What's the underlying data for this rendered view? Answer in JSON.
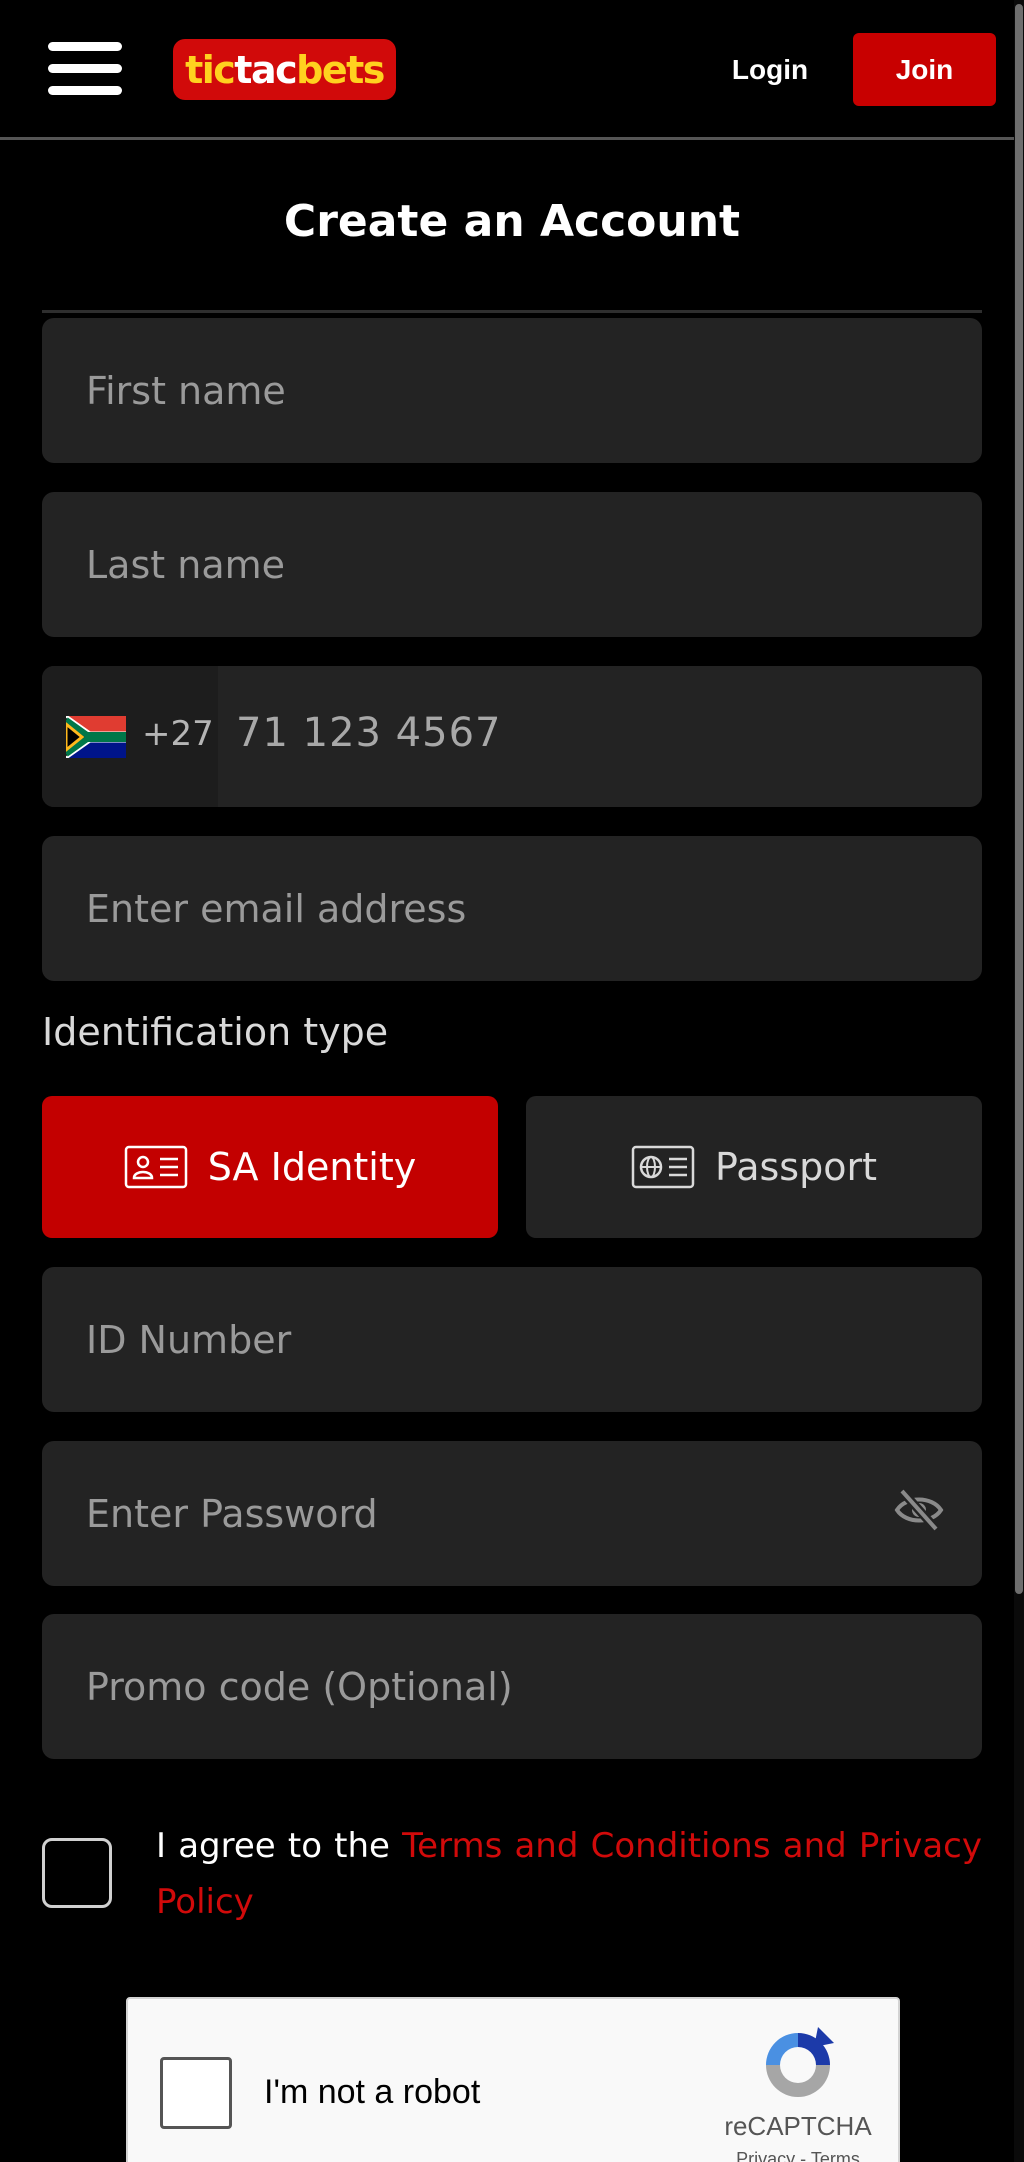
{
  "header": {
    "logo": {
      "part1": "tic",
      "part2": "tac",
      "part3": "bets"
    },
    "login_label": "Login",
    "join_label": "Join"
  },
  "page_title": "Create an Account",
  "form": {
    "first_name_placeholder": "First name",
    "last_name_placeholder": "Last name",
    "phone": {
      "country_flag": "south-africa-flag",
      "dial_code": "+27",
      "placeholder": "71 123 4567"
    },
    "email_placeholder": "Enter email address",
    "identification_label": "Identification type",
    "id_types": [
      {
        "label": "SA Identity",
        "icon": "id-card-icon",
        "selected": true
      },
      {
        "label": "Passport",
        "icon": "passport-icon",
        "selected": false
      }
    ],
    "id_number_placeholder": "ID Number",
    "password_placeholder": "Enter Password",
    "promo_placeholder": "Promo code (Optional)",
    "agree_prefix": "I agree to the ",
    "agree_link": "Terms and Conditions and Privacy Policy"
  },
  "recaptcha": {
    "label": "I'm not a robot",
    "brand": "reCAPTCHA",
    "links": "Privacy - Terms"
  },
  "colors": {
    "accent_red": "#c80000",
    "logo_yellow": "#ffd21f",
    "field_bg": "#232323",
    "page_bg": "#000000"
  }
}
